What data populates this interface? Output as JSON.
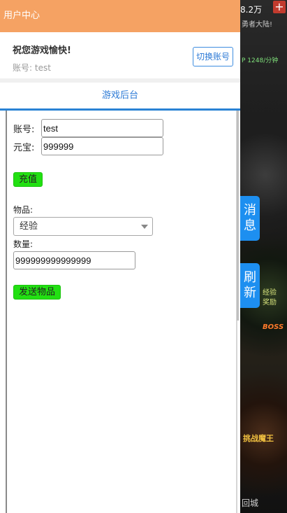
{
  "game": {
    "score": "8.2万",
    "plus_icon": "+",
    "subtitle": "勇者大陆!",
    "rate": "P 1248/分钟",
    "reward_text": "经验\n奖励",
    "boss_text": "BOSS",
    "challenge_text": "挑战魔王",
    "city_text": "回城"
  },
  "side_buttons": {
    "message": "消息",
    "refresh": "刷新"
  },
  "panel": {
    "title": "用户中心",
    "greeting": "祝您游戏愉快!",
    "account_label": "账号:",
    "account_name": "test",
    "switch_label": "切换账号",
    "tab_label": "游戏后台"
  },
  "form": {
    "account_label": "账号:",
    "account_value": "test",
    "yuanbao_label": "元宝:",
    "yuanbao_value": "999999",
    "recharge_label": "充值",
    "item_label": "物品:",
    "item_selected": "经验",
    "qty_label": "数量:",
    "qty_value": "999999999999999",
    "send_label": "发送物品"
  },
  "colors": {
    "header_bg": "#f5a263",
    "accent_blue": "#2c7ad6",
    "side_button_blue": "#1d8ff0",
    "green_button": "#22e012"
  }
}
